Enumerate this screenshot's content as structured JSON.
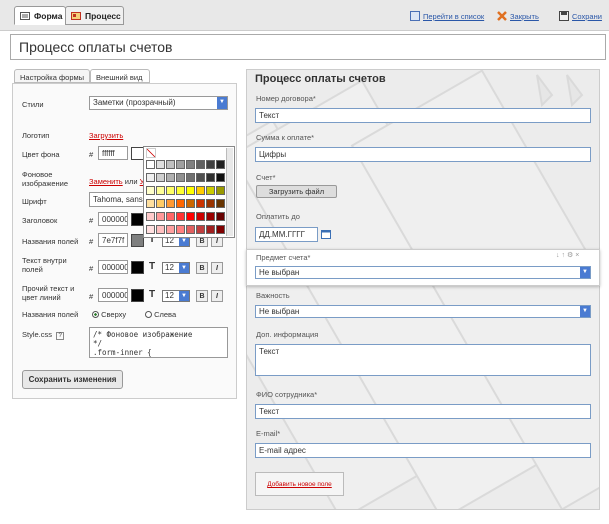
{
  "topbar": {
    "tab_form": "Форма",
    "tab_process": "Процесс",
    "link_list": "Перейти в список",
    "link_close": "Закрыть",
    "link_save": "Сохрани"
  },
  "title": "Процесс оплаты счетов",
  "left": {
    "tab_settings": "Настройка формы",
    "tab_view": "Внешний вид",
    "styles_label": "Стили",
    "styles_value": "Заметки (прозрачный)",
    "logo_label": "Логотип",
    "logo_link": "Загрузить",
    "bg_color_label": "Цвет фона",
    "bg_color_value": "ffffff",
    "bg_image_label": "Фоновое изображение",
    "bg_image_replace": "Заменить",
    "bg_image_or": "или",
    "bg_image_delete": "Уд",
    "font_label": "Шрифт",
    "font_value": "Tahoma, sans",
    "heading_label": "Заголовок",
    "heading_value": "000000",
    "field_names_label": "Названия полей",
    "field_names_value": "7e7f7f",
    "field_names_size": "12",
    "text_fields_label": "Текст внутри полей",
    "text_fields_value": "000000",
    "text_fields_size": "12",
    "other_text_label": "Прочий текст и цвет линий",
    "other_text_value": "000000",
    "other_text_size": "12",
    "field_pos_label": "Названия полей",
    "pos_top": "Сверху",
    "pos_left": "Слева",
    "css_label": "Style.css",
    "css_help": "?",
    "css_code": "/* Фоновое изображение\n*/\n.form-inner {",
    "save_button": "Сохранить изменения",
    "bold_btn": "B",
    "italic_btn": "I"
  },
  "right": {
    "title": "Процесс оплаты счетов",
    "contract_label": "Номер договора*",
    "contract_value": "Текст",
    "amount_label": "Сумма к оплате*",
    "amount_value": "Цифры",
    "invoice_label": "Счет*",
    "invoice_button": "Загрузить файл",
    "pay_until_label": "Оплатить до",
    "pay_until_value": "ДД.ММ.ГГГГ",
    "subject_label": "Предмет счета*",
    "subject_value": "Не выбран",
    "importance_label": "Важность",
    "importance_value": "Не выбран",
    "extra_label": "Доп. информация",
    "extra_value": "Текст",
    "employee_label": "ФИО сотрудника*",
    "employee_value": "Текст",
    "email_label": "E-mail*",
    "email_value": "E-mail адрес",
    "add_field": "Добавить новое поле"
  },
  "palette_colors": [
    "#ffffff",
    "#e0e0e0",
    "#c0c0c0",
    "#a0a0a0",
    "#808080",
    "#606060",
    "#404040",
    "#202020",
    "#f0f0f0",
    "#d0d0d0",
    "#b0b0b0",
    "#909090",
    "#707070",
    "#505050",
    "#303030",
    "#101010",
    "#ffffcc",
    "#ffff99",
    "#ffff66",
    "#ffff33",
    "#ffff00",
    "#ffcc00",
    "#cccc00",
    "#999900",
    "#ffe0a0",
    "#ffcc66",
    "#ff9933",
    "#ff6600",
    "#cc6600",
    "#cc3300",
    "#993300",
    "#663300",
    "#ffcccc",
    "#ff9999",
    "#ff6666",
    "#ff3333",
    "#ff0000",
    "#cc0000",
    "#990000",
    "#660000",
    "#ffe0e0",
    "#ffc0c0",
    "#ffa0a0",
    "#ff8080",
    "#e06060",
    "#c04040",
    "#a02020",
    "#800000"
  ],
  "colors": {
    "accent_blue": "#4a7bd2",
    "link_red": "#cc0000",
    "field_border": "#7a9cc6"
  }
}
